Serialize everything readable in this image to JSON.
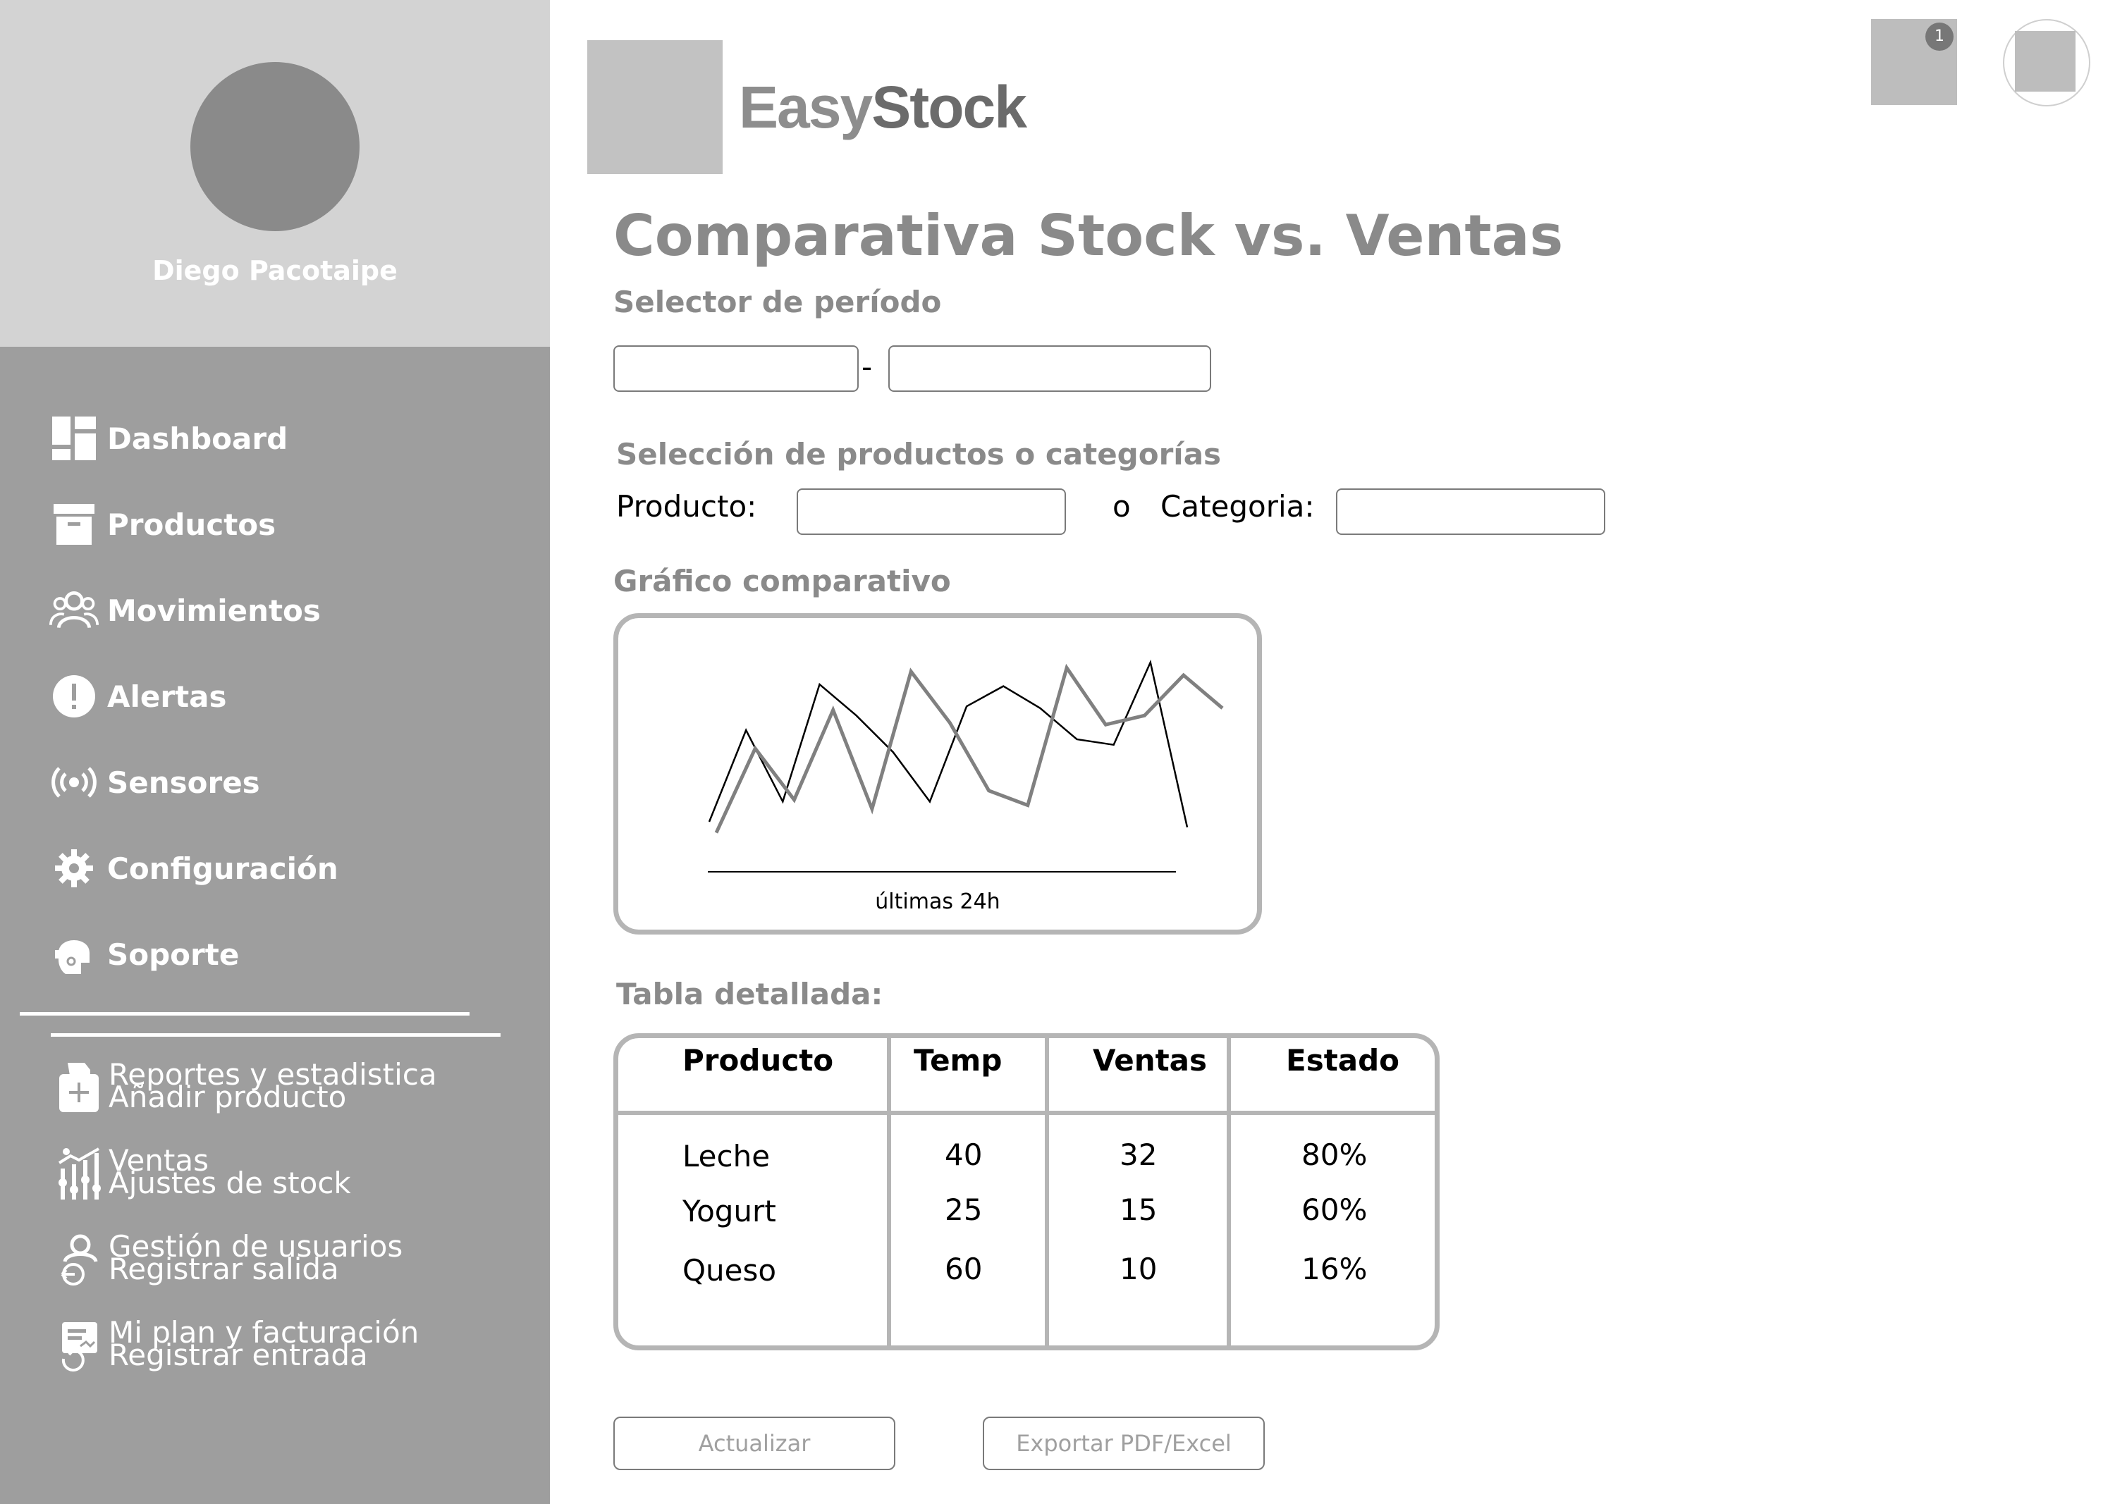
{
  "user": {
    "name": "Diego Pacotaipe"
  },
  "sidebar": {
    "items": [
      {
        "label": "Dashboard",
        "icon": "dashboard-icon"
      },
      {
        "label": "Productos",
        "icon": "box-icon"
      },
      {
        "label": "Movimientos",
        "icon": "users-icon"
      },
      {
        "label": "Alertas",
        "icon": "alert-icon"
      },
      {
        "label": "Sensores",
        "icon": "sensor-icon"
      },
      {
        "label": "Configuración",
        "icon": "gear-icon"
      },
      {
        "label": "Soporte",
        "icon": "support-icon"
      }
    ],
    "overlay_items": [
      {
        "label_back": "Reportes y estadistica",
        "label_front": "Añadir producto",
        "icon": "add-document-icon"
      },
      {
        "label_back": "Ventas",
        "label_front": "Ajustes de stock",
        "icon": "adjust-chart-icon"
      },
      {
        "label_back": "Gestión de usuarios",
        "label_front": "Registrar salida",
        "icon": "user-exit-icon"
      },
      {
        "label_back": "Mi plan y facturación",
        "label_front": "Registrar entrada",
        "icon": "invoice-entry-icon"
      }
    ]
  },
  "header": {
    "brand_light": "Easy",
    "brand_dark": "Stock",
    "notification_count": "1"
  },
  "main": {
    "title": "Comparativa Stock vs. Ventas",
    "period_label": "Selector de período",
    "period_separator": "-",
    "period_start_value": "",
    "period_end_value": "",
    "selection_label": "Selección de productos o categorías",
    "product_label": "Producto:",
    "or_label": "o",
    "category_label": "Categoria:",
    "product_value": "",
    "category_value": "",
    "chart_label": "Gráfico comparativo",
    "table_label": "Tabla detallada:",
    "update_button": "Actualizar",
    "export_button": "Exportar PDF/Excel"
  },
  "chart_data": {
    "type": "line",
    "title": "",
    "xlabel": "últimas 24h",
    "ylabel": "",
    "x": [
      0,
      1,
      2,
      3,
      4,
      5,
      6,
      7,
      8,
      9,
      10,
      11,
      12,
      13
    ],
    "series": [
      {
        "values": [
          10,
          60,
          21,
          85,
          68,
          48,
          21,
          73,
          84,
          72,
          55,
          52,
          97,
          7
        ],
        "color": "#000000"
      },
      {
        "values": [
          4,
          50,
          22,
          71,
          17,
          92,
          64,
          27,
          19,
          94,
          63,
          68,
          90,
          72
        ],
        "color": "#808080"
      }
    ]
  },
  "table": {
    "headers": [
      "Producto",
      "Temp",
      "Ventas",
      "Estado"
    ],
    "rows": [
      [
        "Leche",
        "40",
        "32",
        "80%"
      ],
      [
        "Yogurt",
        "25",
        "15",
        "60%"
      ],
      [
        "Queso",
        "60",
        "10",
        "16%"
      ]
    ]
  }
}
